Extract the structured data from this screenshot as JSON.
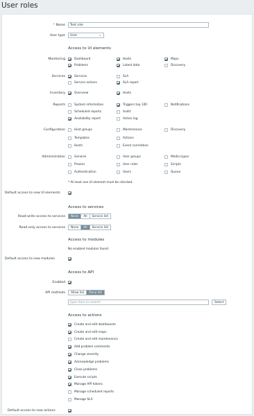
{
  "page": {
    "title": "User roles"
  },
  "form": {
    "name_label": "Name",
    "name_value": "Test role",
    "user_type_label": "User type",
    "user_type_value": "User",
    "ui_section": "Access to UI elements",
    "groups": {
      "monitoring": "Monitoring",
      "services": "Services",
      "inventory": "Inventory",
      "reports": "Reports",
      "configuration": "Configuration",
      "administration": "Administration"
    },
    "items": {
      "dashboard": "Dashboard",
      "hosts": "Hosts",
      "maps": "Maps",
      "problems": "Problems",
      "latest_data": "Latest data",
      "discovery": "Discovery",
      "services": "Services",
      "sla": "SLA",
      "service_actions": "Service actions",
      "sla_report": "SLA report",
      "overview": "Overview",
      "inv_hosts": "Hosts",
      "system_information": "System information",
      "triggers_top_100": "Triggers top 100",
      "notifications": "Notifications",
      "scheduled_reports": "Scheduled reports",
      "audit": "Audit",
      "availability_report": "Availability report",
      "action_log": "Action log",
      "host_groups": "Host groups",
      "maintenance": "Maintenance",
      "conf_discovery": "Discovery",
      "templates": "Templates",
      "actions": "Actions",
      "conf_hosts": "Hosts",
      "event_correlation": "Event correlation",
      "general": "General",
      "user_groups": "User groups",
      "media_types": "Media types",
      "proxies": "Proxies",
      "user_roles": "User roles",
      "scripts": "Scripts",
      "authentication": "Authentication",
      "users": "Users",
      "queue": "Queue"
    },
    "ui_note": "* At least one UI element must be checked.",
    "default_ui_label": "Default access to new UI elements",
    "services_section": "Access to services",
    "rw_label": "Read-write access to services",
    "ro_label": "Read-only access to services",
    "seg_none": "None",
    "seg_all": "All",
    "seg_list": "Service list",
    "modules_section": "Access to modules",
    "modules_note": "No enabled modules found.",
    "default_modules_label": "Default access to new modules",
    "api_section": "Access to API",
    "enabled_label": "Enabled",
    "api_methods_label": "API methods",
    "allow_list": "Allow list",
    "deny_list": "Deny list",
    "api_search_placeholder": "type here to search",
    "select_button": "Select",
    "actions_section": "Access to actions",
    "actions": [
      {
        "label": "Create and edit dashboards",
        "checked": true
      },
      {
        "label": "Create and edit maps",
        "checked": true
      },
      {
        "label": "Create and edit maintenance",
        "checked": false
      },
      {
        "label": "Add problem comments",
        "checked": true
      },
      {
        "label": "Change severity",
        "checked": true
      },
      {
        "label": "Acknowledge problems",
        "checked": true
      },
      {
        "label": "Close problems",
        "checked": true
      },
      {
        "label": "Execute scripts",
        "checked": true
      },
      {
        "label": "Manage API tokens",
        "checked": true
      },
      {
        "label": "Manage scheduled reports",
        "checked": false
      },
      {
        "label": "Manage SLA",
        "checked": false
      }
    ],
    "default_actions_label": "Default access to new actions"
  }
}
